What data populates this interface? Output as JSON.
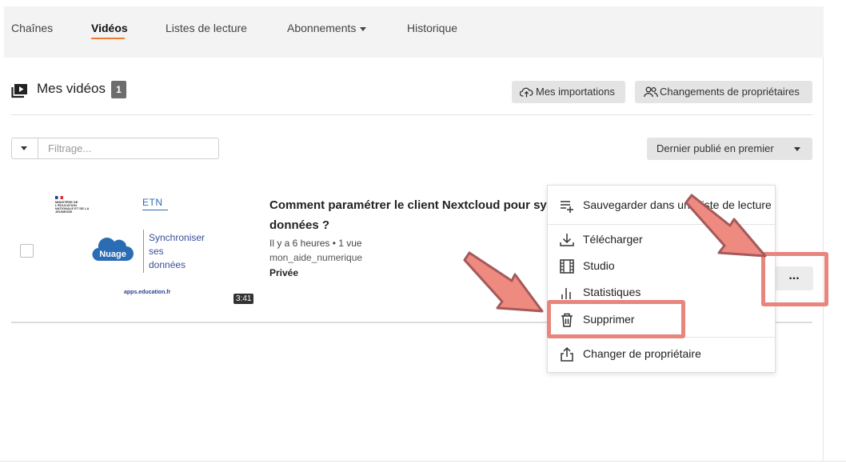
{
  "tabs": [
    {
      "label": "Chaînes",
      "active": false
    },
    {
      "label": "Vidéos",
      "active": true
    },
    {
      "label": "Listes de lecture",
      "active": false
    },
    {
      "label": "Abonnements",
      "active": false
    },
    {
      "label": "Historique",
      "active": false
    }
  ],
  "section": {
    "title": "Mes vidéos",
    "count": "1"
  },
  "header_buttons": {
    "imports": "Mes importations",
    "ownership": "Changements de propriétaires"
  },
  "filter": {
    "placeholder": "Filtrage..."
  },
  "sort": {
    "selected": "Dernier publié en premier"
  },
  "video": {
    "title_line1": "Comment paramétrer le client Nextcloud pour synchroniser ses",
    "title_line2": "données ?",
    "meta": "Il y a 6 heures • 1 vue",
    "channel": "mon_aide_numerique",
    "privacy": "Privée",
    "duration": "3:41",
    "thumbnail": {
      "ministry": "MINISTÈRE DE L'ÉDUCATION NATIONALE ET DE LA JEUNESSE",
      "etn": "ETN",
      "nuage": "Nuage",
      "text_lines": [
        "Synchroniser",
        "ses",
        "données"
      ],
      "footer": "apps.education.fr"
    }
  },
  "menu": {
    "items": [
      {
        "label": "Sauvegarder dans une liste de lecture",
        "icon": "playlist-add-icon"
      },
      {
        "label": "Télécharger",
        "icon": "download-icon"
      },
      {
        "label": "Studio",
        "icon": "film-icon"
      },
      {
        "label": "Statistiques",
        "icon": "bar-chart-icon"
      },
      {
        "label": "Supprimer",
        "icon": "trash-icon"
      },
      {
        "label": "Changer de propriétaire",
        "icon": "share-icon"
      }
    ]
  },
  "more_button": "...",
  "colors": {
    "accent": "#ef7a32",
    "annotation": "#e8867d",
    "nuage_blue": "#2a6db5"
  }
}
